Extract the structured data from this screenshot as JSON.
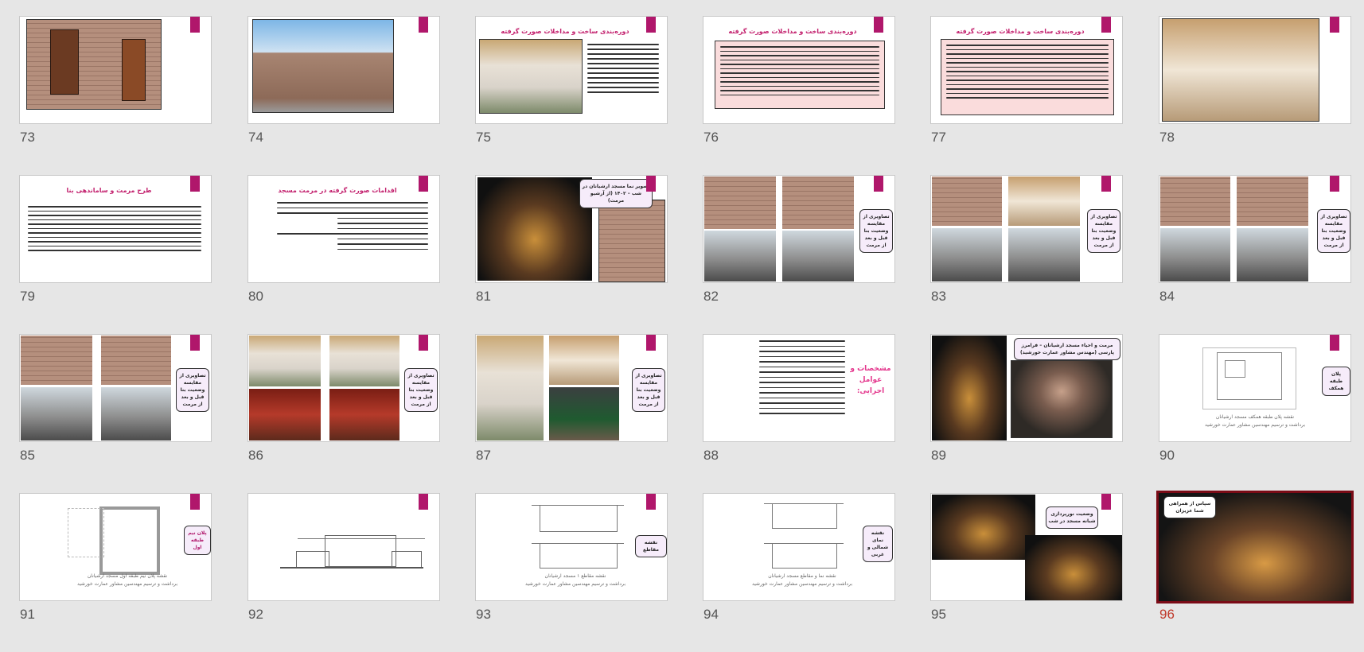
{
  "slides": [
    {
      "num": "73"
    },
    {
      "num": "74"
    },
    {
      "num": "75",
      "title": "دوره‌بندی ساخت و مداخلات صورت گرفته"
    },
    {
      "num": "76",
      "title": "دوره‌بندی ساخت و مداخلات صورت گرفته"
    },
    {
      "num": "77",
      "title": "دوره‌بندی ساخت و مداخلات صورت گرفته"
    },
    {
      "num": "78"
    },
    {
      "num": "79",
      "title": "طرح مرمت و ساماندهی بنا"
    },
    {
      "num": "80",
      "title": "اقدامات صورت گرفته در مرمت مسجد"
    },
    {
      "num": "81",
      "label": "تصویر نما مسجد ارشیانان در شب – ۱۴۰۲ (از آرشیو مرمت)"
    },
    {
      "num": "82",
      "label": "تصاویری از مقایسه وضعیت بنا قبل و بعد از مرمت"
    },
    {
      "num": "83",
      "label": "تصاویری از مقایسه وضعیت بنا قبل و بعد از مرمت"
    },
    {
      "num": "84",
      "label": "تصاویری از مقایسه وضعیت بنا قبل و بعد از مرمت"
    },
    {
      "num": "85",
      "label": "تصاویری از مقایسه وضعیت بنا قبل و بعد از مرمت"
    },
    {
      "num": "86",
      "label": "تصاویری از مقایسه وضعیت بنا قبل و بعد از مرمت"
    },
    {
      "num": "87",
      "label": "تصاویری از مقایسه وضعیت بنا قبل و بعد از مرمت"
    },
    {
      "num": "88",
      "title": "مشخصات و عوامل اجرایی:"
    },
    {
      "num": "89",
      "label": "مرمت و احیاء مسجد ارشیانان – فرامرز پارسی (مهندس مشاور عمارت خورشید)"
    },
    {
      "num": "90",
      "label": "پلان طبقه همکف",
      "caption": "نقشه پلان طبقه همکف مسجد ارشیانان",
      "caption2": "برداشت و ترسیم مهندسین مشاور عمارت خورشید"
    },
    {
      "num": "91",
      "label": "پلان نیم طبقه اول",
      "caption": "نقشه پلان نیم طبقه اول مسجد ارشیانان",
      "caption2": "برداشت و ترسیم مهندسین مشاور عمارت خورشید"
    },
    {
      "num": "92"
    },
    {
      "num": "93",
      "label": "نقشه مقاطع",
      "caption": "نقشه مقاطع ۱ مسجد ارشیانان",
      "caption2": "برداشت و ترسیم مهندسین مشاور عمارت خورشید"
    },
    {
      "num": "94",
      "label": "نقشه نمای شمالی و غربی",
      "caption": "نقشه نما و مقاطع مسجد ارشیانان",
      "caption2": "برداشت و ترسیم مهندسین مشاور عمارت خورشید"
    },
    {
      "num": "95",
      "label": "وضعیت نورپردازی شبانه مسجد در شب"
    },
    {
      "num": "96",
      "label": "سپاس از همراهی شما عزیزان"
    }
  ]
}
